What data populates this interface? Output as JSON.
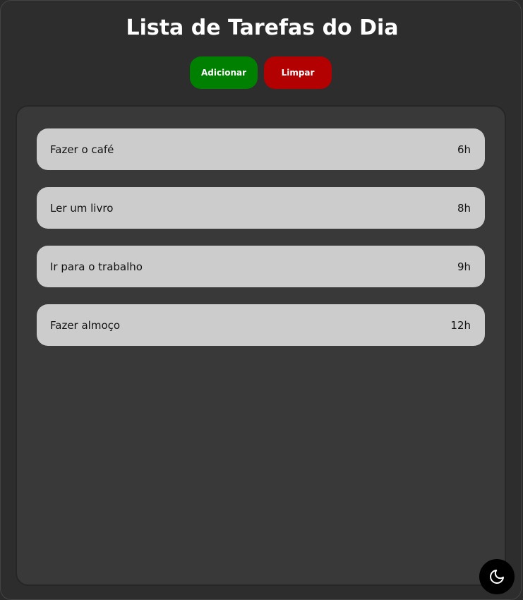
{
  "header": {
    "title": "Lista de Tarefas do Dia"
  },
  "toolbar": {
    "add_label": "Adicionar",
    "clear_label": "Limpar",
    "add_color": "#008000",
    "clear_color": "#b30000"
  },
  "tasks": [
    {
      "name": "Fazer o café",
      "time": "6h"
    },
    {
      "name": "Ler um livro",
      "time": "8h"
    },
    {
      "name": "Ir para o trabalho",
      "time": "9h"
    },
    {
      "name": "Fazer almoço",
      "time": "12h"
    }
  ],
  "theme_toggle": {
    "icon": "moon-icon"
  }
}
